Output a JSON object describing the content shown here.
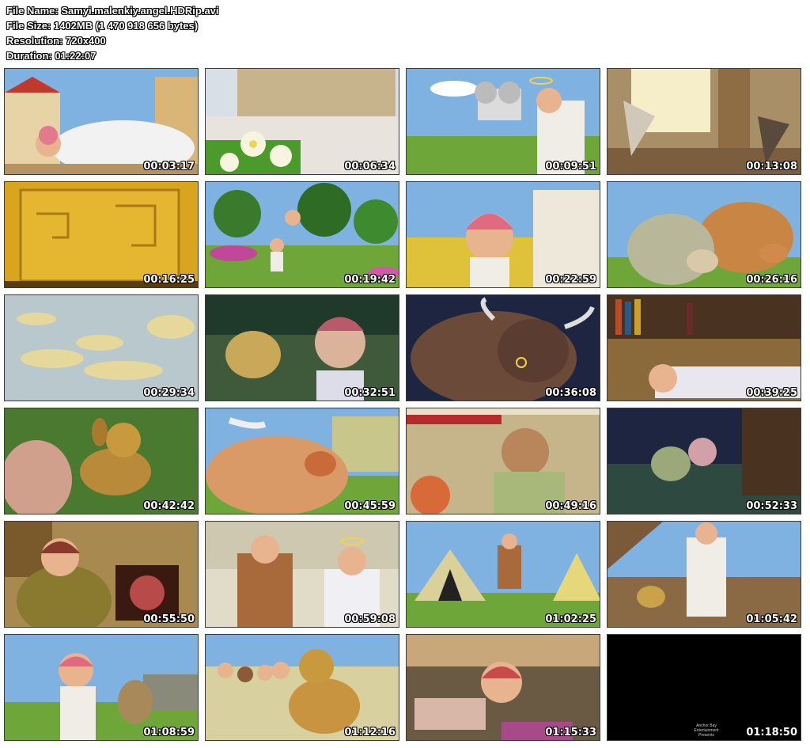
{
  "header": {
    "file_name": "File Name: Samyi.malenkiy.angel.HDRip.avi",
    "file_size": "File Size: 1402MB (1 470 918 656 bytes)",
    "resolution": "Resolution: 720x400",
    "duration": "Duration: 01:22:07"
  },
  "thumbnails": [
    {
      "time": "00:03:17",
      "scene": "angel-village-cloud"
    },
    {
      "time": "00:06:34",
      "scene": "white-flowers-street"
    },
    {
      "time": "00:09:51",
      "scene": "angel-with-camera"
    },
    {
      "time": "00:13:08",
      "scene": "winged-figures-hall"
    },
    {
      "time": "00:16:25",
      "scene": "golden-door"
    },
    {
      "time": "00:19:42",
      "scene": "garden-path"
    },
    {
      "time": "00:22:59",
      "scene": "little-angel-closeup"
    },
    {
      "time": "00:26:16",
      "scene": "donkey-and-ox"
    },
    {
      "time": "00:29:34",
      "scene": "golden-clouds"
    },
    {
      "time": "00:32:51",
      "scene": "puppy-and-angel-night"
    },
    {
      "time": "00:36:08",
      "scene": "bull-at-night"
    },
    {
      "time": "00:39:25",
      "scene": "library-sleeping-angel"
    },
    {
      "time": "00:42:42",
      "scene": "puppy-on-grass"
    },
    {
      "time": "00:45:59",
      "scene": "ox-in-meadow"
    },
    {
      "time": "00:49:16",
      "scene": "market-merchant"
    },
    {
      "time": "00:52:33",
      "scene": "puppy-angel-night-floor"
    },
    {
      "time": "00:55:50",
      "scene": "woman-with-basket"
    },
    {
      "time": "00:59:08",
      "scene": "soldier-and-angel"
    },
    {
      "time": "01:02:25",
      "scene": "tents-camp"
    },
    {
      "time": "01:05:42",
      "scene": "angel-on-deck"
    },
    {
      "time": "01:08:59",
      "scene": "angel-and-puppy"
    },
    {
      "time": "01:12:16",
      "scene": "children-and-puppy"
    },
    {
      "time": "01:15:33",
      "scene": "angel-golden-room"
    },
    {
      "time": "01:18:50",
      "scene": "end-credits-black"
    }
  ],
  "end_credit": "Anchor Bay Entertainment Presents",
  "colors": {
    "sky": "#7fb2e0",
    "grass": "#6fa63a",
    "gold": "#d9a51e",
    "night": "#1d2540",
    "skin": "#e8b48f"
  }
}
